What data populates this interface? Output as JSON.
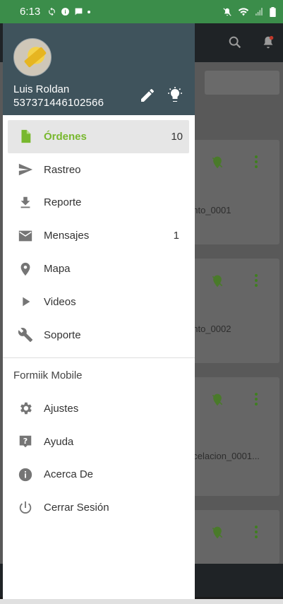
{
  "status": {
    "time": "6:13",
    "bar_color": "#3b8d4a"
  },
  "app_behind": {
    "card_texts": [
      "ento_0001",
      "ento_0002",
      "ncelacion_0001..."
    ]
  },
  "drawer": {
    "header_color": "#3f535c",
    "user": {
      "name": "Luis Roldan",
      "id": "537371446102566"
    },
    "header_icons": [
      "edit-icon",
      "lightbulb-icon"
    ],
    "menu": [
      {
        "label": "Órdenes",
        "icon": "document-icon",
        "count": "10",
        "active": true
      },
      {
        "label": "Rastreo",
        "icon": "send-icon",
        "count": ""
      },
      {
        "label": "Reporte",
        "icon": "download-icon",
        "count": ""
      },
      {
        "label": "Mensajes",
        "icon": "mail-icon",
        "count": "1"
      },
      {
        "label": "Mapa",
        "icon": "location-pin-icon",
        "count": ""
      },
      {
        "label": "Videos",
        "icon": "play-icon",
        "count": ""
      },
      {
        "label": "Soporte",
        "icon": "wrench-icon",
        "count": ""
      }
    ],
    "section_title": "Formiik Mobile",
    "menu2": [
      {
        "label": "Ajustes",
        "icon": "gear-icon"
      },
      {
        "label": "Ayuda",
        "icon": "help-icon"
      },
      {
        "label": "Acerca De",
        "icon": "info-icon"
      },
      {
        "label": "Cerrar Sesión",
        "icon": "power-icon"
      }
    ],
    "accent_color": "#78b82e"
  }
}
